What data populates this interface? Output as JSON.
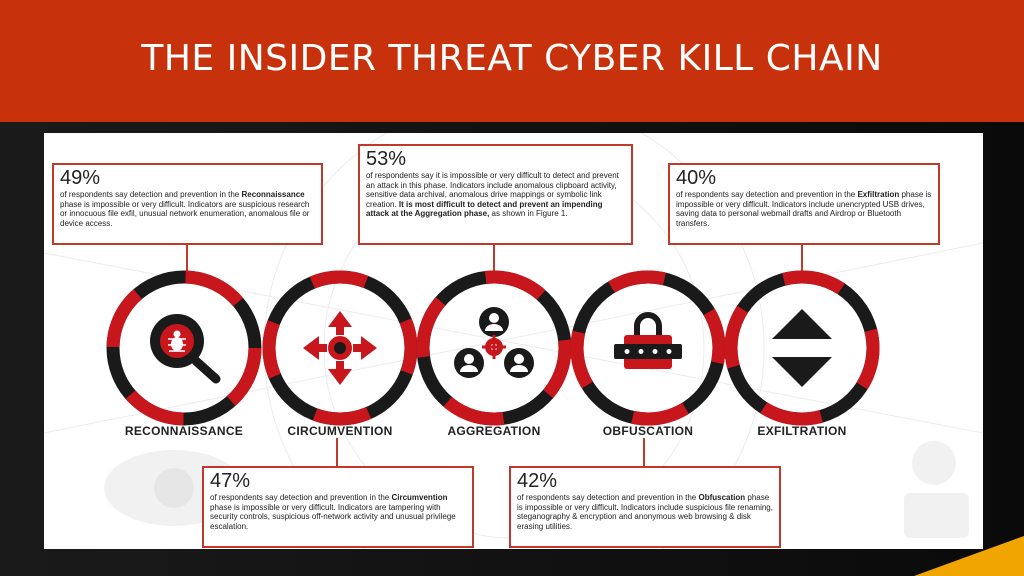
{
  "slide": {
    "title": "THE INSIDER THREAT CYBER KILL CHAIN"
  },
  "colors": {
    "header": "#c7320c",
    "ring_red": "#c8161d",
    "ring_black": "#1a1a1a",
    "box_border": "#c0392b",
    "accent": "#f0a500"
  },
  "phases": [
    {
      "label": "RECONNAISSANCE",
      "icon": "bug-magnifier-icon",
      "percent": "49%",
      "text_pre": "of respondents say detection and prevention in the ",
      "bold": "Reconnaissance",
      "text_post": " phase is impossible or very difficult. Indicators are suspicious research or innocuous file exfil, unusual network enumeration, anomalous file or device access."
    },
    {
      "label": "CIRCUMVENTION",
      "icon": "four-arrows-target-icon",
      "percent": "47%",
      "text_pre": "of respondents say detection and prevention in the ",
      "bold": "Circumvention",
      "text_post": " phase is impossible or very difficult. Indicators are tampering with security controls, suspicious off-network activity and unusual privilege escalation."
    },
    {
      "label": "AGGREGATION",
      "icon": "users-gear-icon",
      "percent": "53%",
      "text_pre": "of respondents say it is impossible or very difficult to detect and prevent an attack in this phase. Indicators include anomalous clipboard activity, sensitive data archival, anomalous drive mappings or symbolic link creation. ",
      "bold": "It is most difficult to detect and prevent an impending attack at the Aggregation phase,",
      "text_post": " as shown in Figure 1."
    },
    {
      "label": "OBFUSCATION",
      "icon": "padlock-password-icon",
      "percent": "42%",
      "text_pre": "of respondents say detection and prevention in the ",
      "bold": "Obfuscation",
      "text_post": " phase is impossible or very difficult. Indicators include suspicious file renaming, steganography & encryption and anonymous web browsing & disk erasing utilities."
    },
    {
      "label": "EXFILTRATION",
      "icon": "up-down-arrows-icon",
      "percent": "40%",
      "text_pre": "of respondents say detection and prevention in the ",
      "bold": "Exfiltration",
      "text_post": " phase is impossible or very difficult. Indicators include unencrypted USB drives, saving data to personal webmail drafts and Airdrop or Bluetooth transfers."
    }
  ]
}
